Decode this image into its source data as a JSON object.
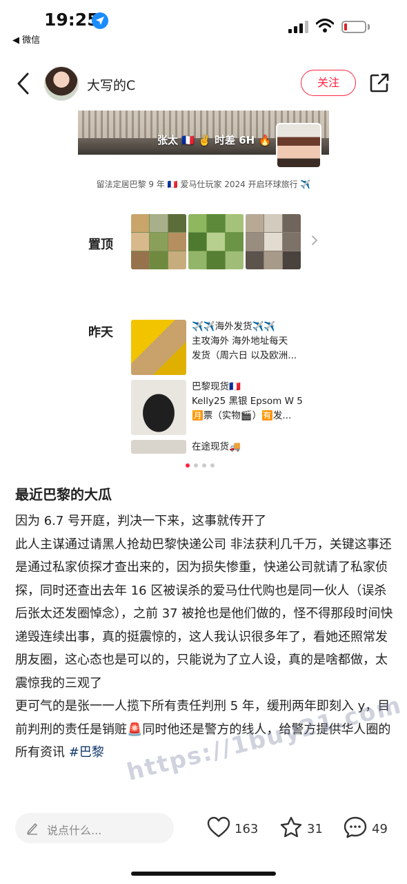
{
  "status_bar": {
    "time": "19:25",
    "back_app": "◀ 微信"
  },
  "nav": {
    "author": "大写的C",
    "follow_label": "关注"
  },
  "banner": {
    "text": "张太 🇫🇷 ✌️ 时差 6H 🔥"
  },
  "bio": "留法定居巴黎 9 年 🇫🇷 爱马仕玩家 2024 开启环球旅行 ✈️",
  "pinned": {
    "label": "置顶"
  },
  "yesterday": {
    "label": "昨天",
    "items": [
      {
        "lines": [
          "✈️✈️海外发货✈️✈️",
          "主攻海外  海外地址每天",
          "发货（周六日 以及欧洲..."
        ]
      },
      {
        "lines": [
          "巴黎现货🇫🇷",
          "Kelly25 黑银 Epsom W 5",
          "🈷️票（实物🎬）🈶发..."
        ]
      },
      {
        "lines": [
          "在途现货🚚"
        ]
      }
    ]
  },
  "post": {
    "title": "最近巴黎的大瓜",
    "paragraphs": [
      "因为 6.7 号开庭，判决一下来，这事就传开了",
      "此人主谋通过请黑人抢劫巴黎快递公司 非法获利几千万，关键这事还是通过私家侦探才查出来的，因为损失惨重，快递公司就请了私家侦探，同时还查出去年 16 区被误杀的爱马仕代购也是同一伙人（误杀后张太还发圈悼念），之前 37 被抢也是他们做的，怪不得那段时间快递毁连续出事，真的挺震惊的，这人我认识很多年了，看她还照常发朋友圈，这心态也是可以的，只能说为了立人设，真的是啥都做，太震惊我的三观了",
      "更可气的是张一一人揽下所有责任判刑 5 年，缓刑两年即刻入 y，目前判刑的责任是销赃🚨同时他还是警方的线人，给警方提供华人圈的所有资讯"
    ],
    "hashtag": "#巴黎",
    "watermark": "https://1buy21.com"
  },
  "bottom_bar": {
    "comment_placeholder": "说点什么...",
    "likes": "163",
    "stars": "31",
    "comments": "49"
  },
  "colors": {
    "accent": "#ff2442",
    "hashtag": "#13386c"
  }
}
